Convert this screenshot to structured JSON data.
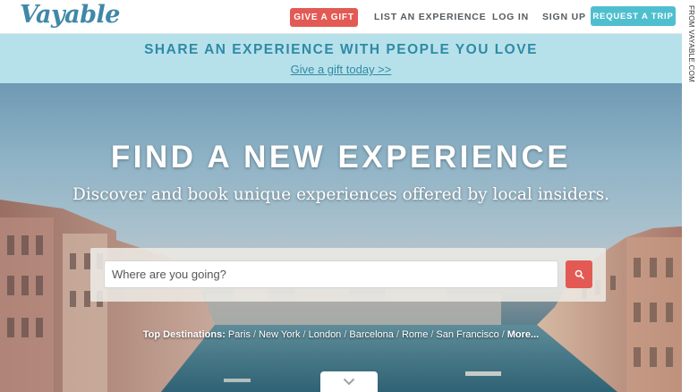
{
  "nav": {
    "logo": "Vayable",
    "gift_button": "GIVE A GIFT",
    "list_experience": "LIST AN EXPERIENCE",
    "login": "LOG IN",
    "signup": "SIGN UP",
    "request_trip_button": "REQUEST A TRIP"
  },
  "promo": {
    "title": "SHARE AN EXPERIENCE WITH PEOPLE YOU LOVE",
    "link": "Give a gift today >>"
  },
  "hero": {
    "title": "FIND A NEW EXPERIENCE",
    "subtitle": "Discover and book unique experiences offered by local insiders.",
    "search": {
      "placeholder": "Where are you going?",
      "button_icon": "search-icon"
    },
    "destinations": {
      "label": "Top Destinations:",
      "items": [
        "Paris",
        "New York",
        "London",
        "Barcelona",
        "Rome",
        "San Francisco"
      ],
      "more": "More..."
    },
    "scroll_icon": "chevron-down-icon"
  },
  "credit": "FROM VAYABLE.COM",
  "colors": {
    "brand_blue": "#3f88a6",
    "gift_red": "#e35a55",
    "trip_teal": "#4fbfd0",
    "promo_bg": "#b7e1ea"
  }
}
